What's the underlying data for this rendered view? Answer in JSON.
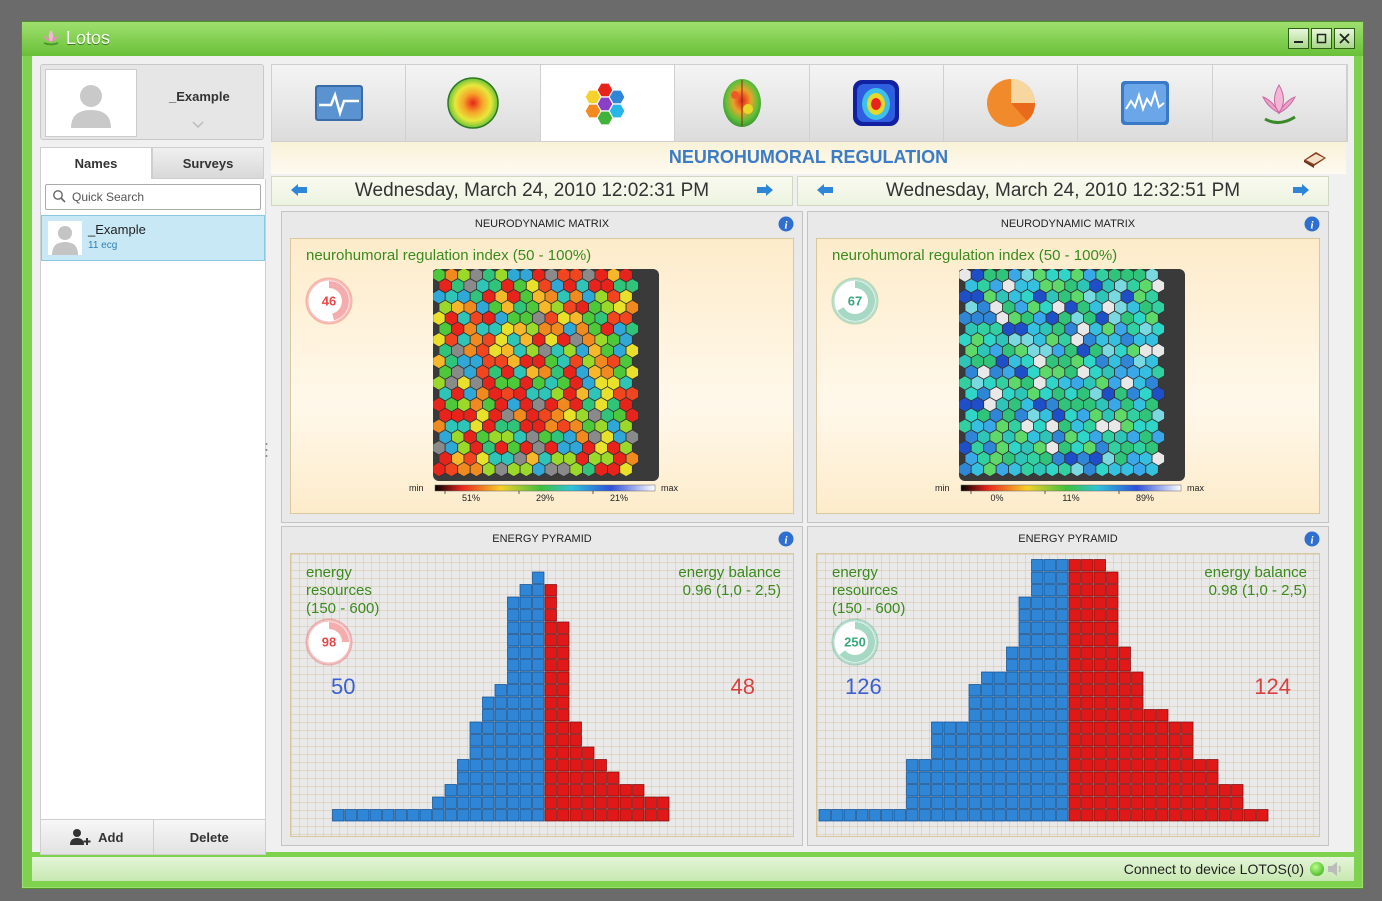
{
  "window": {
    "title": "Lotos"
  },
  "profile": {
    "name": "_Example"
  },
  "tabs": [
    "Names",
    "Surveys"
  ],
  "search": {
    "placeholder": "Quick Search"
  },
  "list": [
    {
      "name": "_Example",
      "sub": "11 ecg"
    }
  ],
  "bottom": {
    "add_label": "Add",
    "delete_label": "Delete"
  },
  "toolbar": {
    "icons": [
      "ecg-wave-icon",
      "heat-sphere-icon",
      "hexagon-cluster-icon",
      "brain-map-icon",
      "body-heatmap-icon",
      "pie-chart-icon",
      "spectrum-chart-icon",
      "lotus-icon"
    ],
    "active_index": 2
  },
  "heading": {
    "title": "NEUROHUMORAL REGULATION"
  },
  "dates": {
    "left": "Wednesday, March 24, 2010 12:02:31 PM",
    "right": "Wednesday, March 24, 2010 12:32:51 PM"
  },
  "matrix": {
    "title": "NEURODYNAMIC MATRIX",
    "index_label": "neurohumoral regulation index (50 - 100%)",
    "legend_min": "min",
    "legend_max": "max",
    "left": {
      "value": "46",
      "value_pct": 46,
      "color": "#e84848",
      "legend": [
        "51%",
        "29%",
        "21%"
      ],
      "palette": "warm"
    },
    "right": {
      "value": "67",
      "value_pct": 67,
      "color": "#3aa87a",
      "legend": [
        "0%",
        "11%",
        "89%"
      ],
      "palette": "cool"
    }
  },
  "pyramid": {
    "title": "ENERGY PYRAMID",
    "resources_label": [
      "energy",
      "resources",
      "(150 - 600)"
    ],
    "balance_label": "energy balance",
    "left": {
      "gauge": "98",
      "gauge_pct": 25,
      "color": "#e84848",
      "balance": "0.96 (1,0 - 2,5)",
      "blue": "50",
      "red": "48",
      "blue_cols": [
        1,
        1,
        1,
        1,
        1,
        1,
        1,
        1,
        2,
        3,
        5,
        8,
        10,
        11,
        18,
        19,
        20
      ],
      "red_cols": [
        19,
        16,
        8,
        6,
        5,
        4,
        3,
        3,
        2,
        2
      ]
    },
    "right": {
      "gauge": "250",
      "gauge_pct": 64,
      "color": "#3aa87a",
      "balance": "0.98 (1,0 - 2,5)",
      "blue": "126",
      "red": "124",
      "blue_cols": [
        1,
        1,
        1,
        1,
        1,
        1,
        1,
        5,
        5,
        8,
        8,
        8,
        11,
        12,
        12,
        14,
        18,
        21,
        21,
        21
      ],
      "red_cols": [
        21,
        21,
        21,
        20,
        14,
        12,
        9,
        9,
        8,
        8,
        5,
        5,
        3,
        3,
        1,
        1
      ]
    }
  },
  "status": {
    "text": "Connect to device LOTOS(0)"
  },
  "colors": {
    "accent": "#3c7cc7",
    "frame": "#7ed24e",
    "blue": "#2f86d6",
    "red": "#e01818"
  }
}
